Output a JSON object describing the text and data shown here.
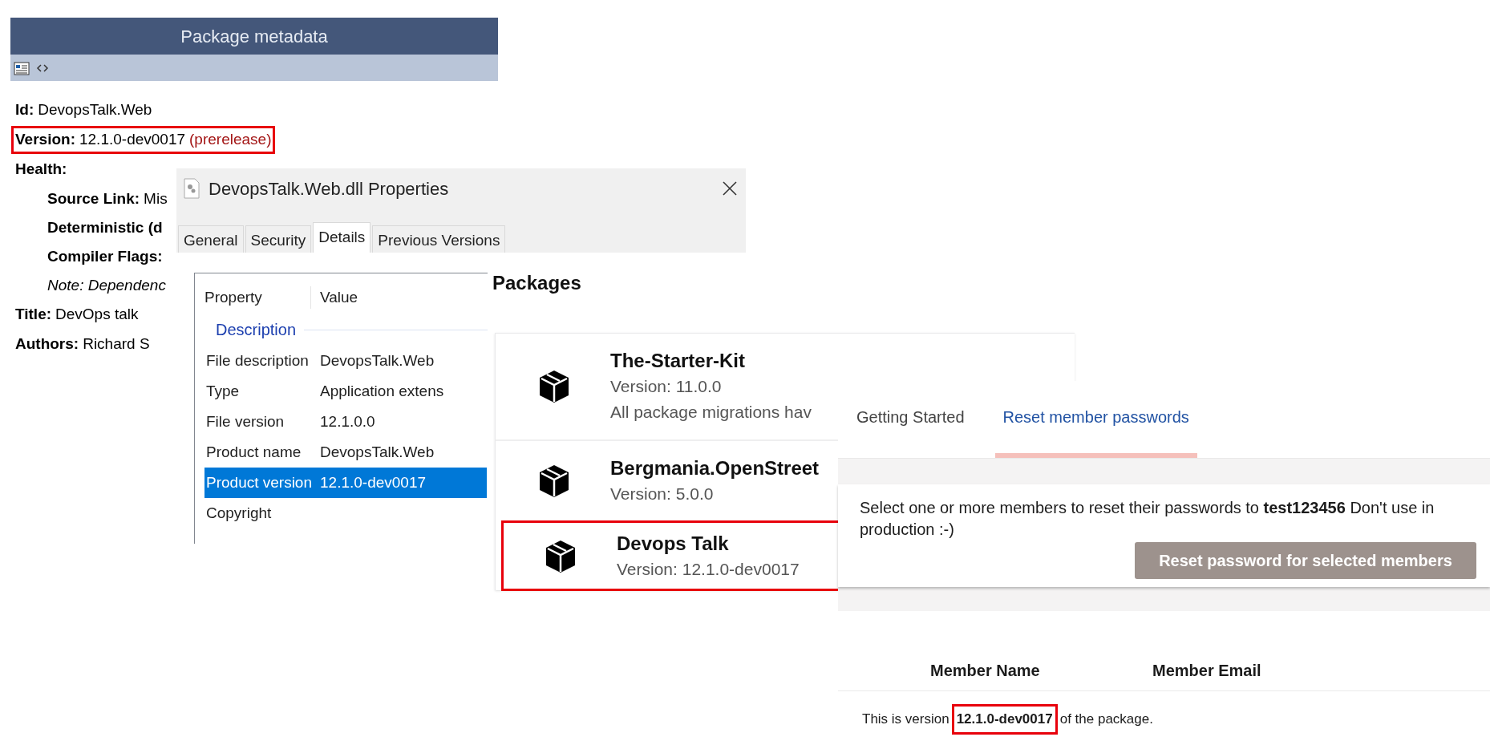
{
  "metadata_panel": {
    "title": "Package metadata",
    "fields": [
      {
        "label": "Id:",
        "value": "DevopsTalk.Web",
        "highlighted": false
      },
      {
        "label": "Version:",
        "value": "12.1.0-dev0017",
        "suffix": "(prerelease)",
        "highlighted": true
      },
      {
        "label": "Health:",
        "highlighted": false,
        "children": [
          {
            "kind": "field",
            "label": "Source Link:",
            "value": "Mis"
          },
          {
            "kind": "field",
            "label": "Deterministic (d"
          },
          {
            "kind": "field",
            "label": "Compiler Flags:"
          },
          {
            "kind": "note",
            "text": "Note: Dependenc"
          }
        ]
      },
      {
        "label": "Title:",
        "value": "DevOps talk",
        "highlighted": false
      },
      {
        "label": "Authors:",
        "value": "Richard S",
        "highlighted": false
      }
    ]
  },
  "properties_dialog": {
    "title": "DevopsTalk.Web.dll Properties",
    "tabs": [
      {
        "label": "General",
        "selected": false
      },
      {
        "label": "Security",
        "selected": false
      },
      {
        "label": "Details",
        "selected": true
      },
      {
        "label": "Previous Versions",
        "selected": false
      }
    ],
    "columns": [
      "Property",
      "Value"
    ],
    "group": "Description",
    "rows": [
      {
        "property": "File description",
        "value": "DevopsTalk.Web",
        "selected": false
      },
      {
        "property": "Type",
        "value": "Application extens",
        "selected": false
      },
      {
        "property": "File version",
        "value": "12.1.0.0",
        "selected": false
      },
      {
        "property": "Product name",
        "value": "DevopsTalk.Web",
        "selected": false
      },
      {
        "property": "Product version",
        "value": "12.1.0-dev0017",
        "selected": true
      },
      {
        "property": "Copyright",
        "selected": false
      }
    ]
  },
  "packages": {
    "title": "Packages",
    "items": [
      {
        "name": "The-Starter-Kit",
        "version": "Version: 11.0.0",
        "note": "All package migrations hav",
        "highlighted": false
      },
      {
        "name": "Bergmania.OpenStreet",
        "version": "Version: 5.0.0",
        "highlighted": false
      },
      {
        "name": "Devops Talk",
        "version": "Version: 12.1.0-dev0017",
        "highlighted": true
      }
    ]
  },
  "dashboard": {
    "tabs": [
      {
        "label": "Getting Started",
        "selected": false
      },
      {
        "label": "Reset member passwords",
        "selected": true
      }
    ],
    "message": "Select one or more members to reset their passwords to **test123456** Don't use in production :-)",
    "button": {
      "label": "Reset password for selected members",
      "disabled": true
    },
    "columns": [
      "Member Name",
      "Member Email"
    ],
    "footer": {
      "before": "This is version",
      "version": "12.1.0-dev0017",
      "after": "of the package.",
      "highlighted": true
    }
  }
}
